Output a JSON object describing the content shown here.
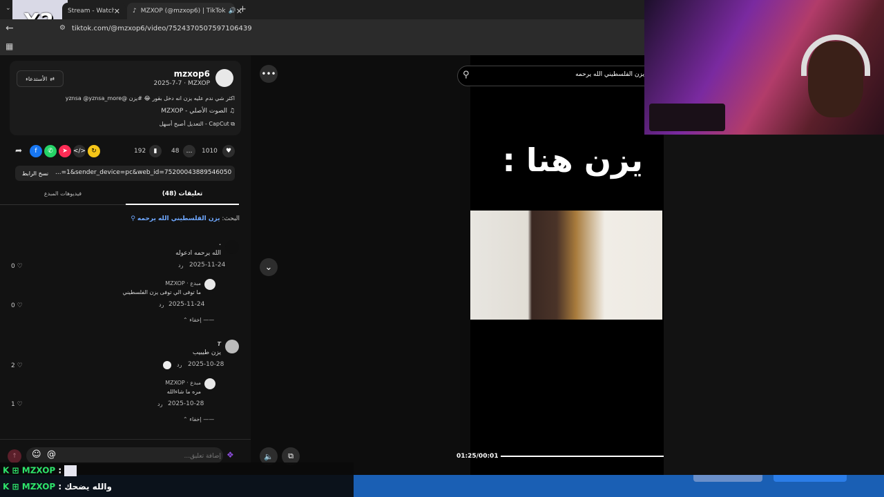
{
  "browser": {
    "tabs": [
      {
        "label": "Stream - Watch l"
      },
      {
        "label": "MZXOP (@mzxop6) | TikTok"
      }
    ],
    "new_tab": "+",
    "url": "tiktok.com/@mzxop6/video/7524370507597106439"
  },
  "overlay": {
    "multiplier": "X2"
  },
  "video_info": {
    "username": "mzxop6",
    "meta": "2025-7-7 · MZXOP",
    "follow_label": "الأستدعاء",
    "caption": "اكثر شي ندم عليه يزن انه دخل بقور 😂 #يزن @yznsa @yznsa_more",
    "sound": "الصوت الأصلي - MZXOP",
    "capcut": "CapCut - التعديل أصبح أسهل"
  },
  "stats": {
    "likes": "1010",
    "comments": "48",
    "saves": "192"
  },
  "link": {
    "copy_label": "نسخ الرابط",
    "value": "...=1&sender_device=pc&web_id=7520004388954605074"
  },
  "tabs": {
    "comments": "(48) تعليقات",
    "creator_videos": "فيديوهات المبدع"
  },
  "search_hint": {
    "prefix": "البحث:",
    "query": "يزن الفلسطيني الله يرحمه"
  },
  "comments": [
    {
      "author": ".",
      "text": "الله يرحمه ادعوله",
      "date": "2025-11-24",
      "reply": "رد",
      "likes": "0",
      "replies": [
        {
          "author": "MZXOP · مبدع",
          "text": "ما توفى الي توفى يزن الفلسطيني",
          "date": "2025-11-24",
          "reply": "رد",
          "likes": "0"
        }
      ],
      "hide": "إخفاء"
    },
    {
      "author": "T",
      "text": "يزن طيبيب",
      "date": "2025-10-28",
      "reply": "رد",
      "likes": "2",
      "replies": [
        {
          "author": "MZXOP · مبدع",
          "text": "مره ما شاءالله",
          "date": "2025-10-28",
          "reply": "رد",
          "likes": "1"
        }
      ],
      "hide": "إخفاء"
    }
  ],
  "comment_input": {
    "placeholder": "إضافة تعليق..."
  },
  "video": {
    "overlay_text": "يزن هنا :",
    "search_text": "يزن الفلسطيني الله يرحمه",
    "time": "01:25/00:01",
    "progress": 1.0
  },
  "chat": [
    {
      "user": "MZXOP",
      "message": ""
    },
    {
      "user": "MZXOP",
      "message": "والله يضحك"
    }
  ],
  "colors": {
    "accent": "#fe2c55",
    "chat_name": "#2ee36a"
  }
}
